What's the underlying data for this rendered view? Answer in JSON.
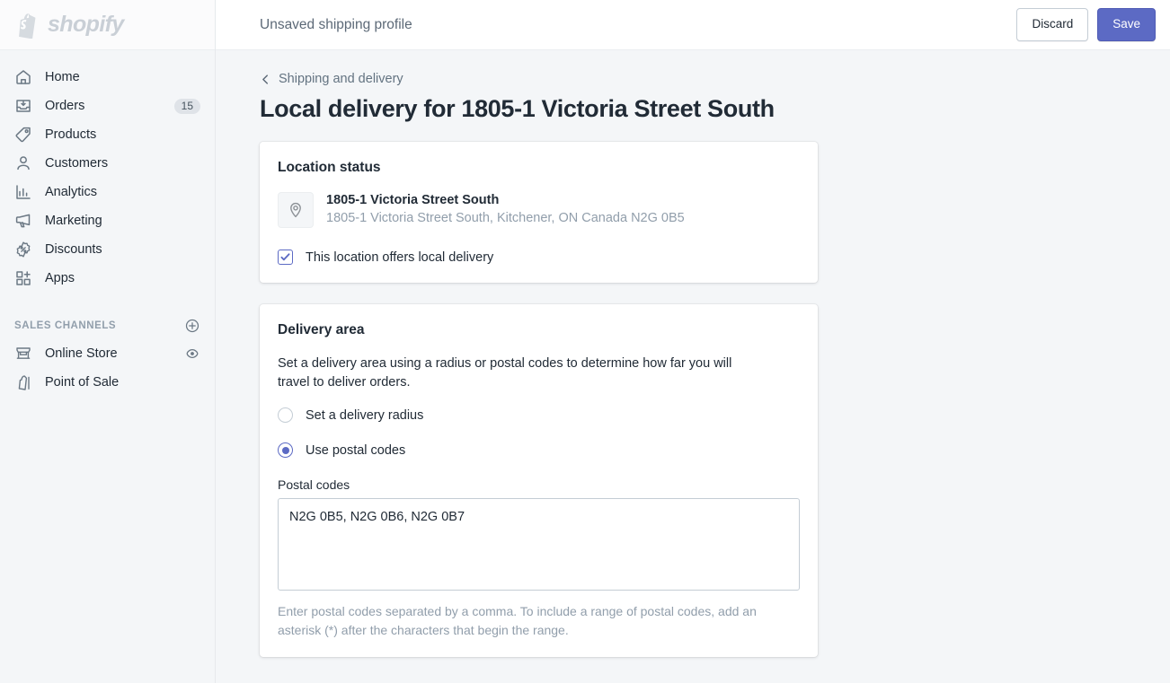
{
  "brand": {
    "name": "shopify",
    "mark_icon": "shopify-bag-icon"
  },
  "sidebar": {
    "items": [
      {
        "label": "Home",
        "icon": "home-icon",
        "badge": ""
      },
      {
        "label": "Orders",
        "icon": "orders-inbox-icon",
        "badge": "15"
      },
      {
        "label": "Products",
        "icon": "products-tag-icon",
        "badge": ""
      },
      {
        "label": "Customers",
        "icon": "customers-person-icon",
        "badge": ""
      },
      {
        "label": "Analytics",
        "icon": "analytics-bars-icon",
        "badge": ""
      },
      {
        "label": "Marketing",
        "icon": "marketing-megaphone-icon",
        "badge": ""
      },
      {
        "label": "Discounts",
        "icon": "discounts-percent-icon",
        "badge": ""
      },
      {
        "label": "Apps",
        "icon": "apps-grid-plus-icon",
        "badge": ""
      }
    ],
    "sales_channels": {
      "title": "SALES CHANNELS",
      "add_icon": "circle-plus-icon",
      "items": [
        {
          "label": "Online Store",
          "icon": "storefront-icon",
          "trailing_icon": "eye-icon"
        },
        {
          "label": "Point of Sale",
          "icon": "pos-bag-icon",
          "trailing_icon": ""
        }
      ]
    }
  },
  "topbar": {
    "title": "Unsaved shipping profile",
    "discard_label": "Discard",
    "save_label": "Save"
  },
  "page": {
    "breadcrumb_label": "Shipping and delivery",
    "breadcrumb_icon": "chevron-left-icon",
    "title": "Local delivery for 1805-1 Victoria Street South"
  },
  "location_status": {
    "title": "Location status",
    "pin_icon": "location-pin-icon",
    "name": "1805-1 Victoria Street South",
    "address": "1805-1 Victoria Street South, Kitchener, ON Canada N2G 0B5",
    "checkbox": {
      "label": "This location offers local delivery",
      "checked": true,
      "icon": "checkmark-icon"
    }
  },
  "delivery_area": {
    "title": "Delivery area",
    "description": "Set a delivery area using a radius or postal codes to determine how far you will travel to deliver orders.",
    "options": [
      {
        "label": "Set a delivery radius",
        "selected": false
      },
      {
        "label": "Use postal codes",
        "selected": true
      }
    ],
    "postal_field": {
      "label": "Postal codes",
      "value": "N2G 0B5, N2G 0B6, N2G 0B7",
      "placeholder": ""
    },
    "help_text": "Enter postal codes separated by a comma. To include a range of postal codes, add an asterisk (*) after the characters that begin the range."
  },
  "colors": {
    "accent": "#5c6ac4",
    "page_bg": "#f4f6f8",
    "text": "#212b36",
    "subdued": "#919eab"
  }
}
